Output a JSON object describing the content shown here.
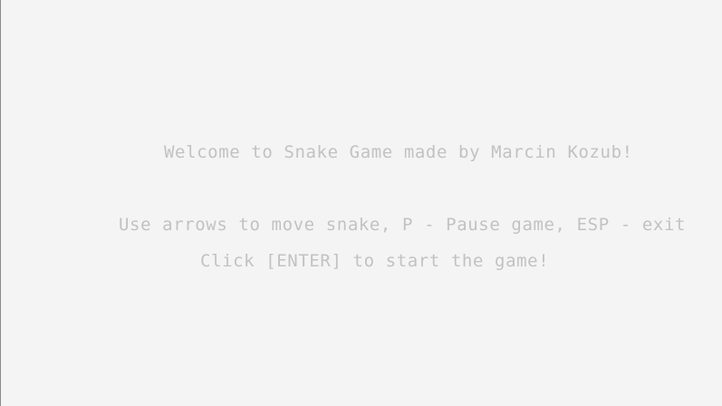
{
  "game": {
    "welcome_text": "Welcome to Snake Game made by Marcin Kozub!",
    "controls_text": "Use arrows to move snake, P - Pause game, ESP - exit",
    "start_prompt": "Click [ENTER] to start the game!"
  },
  "colors": {
    "background": "#f4f4f4",
    "text": "#c2c2c2",
    "border": "#8a8a8a"
  }
}
